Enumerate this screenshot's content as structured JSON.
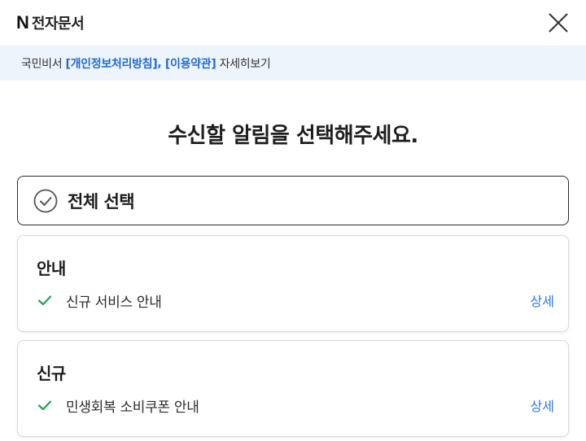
{
  "header": {
    "logo": "N",
    "title": "전자문서"
  },
  "notice": {
    "prefix": "국민비서 ",
    "privacy_link": "[개인정보처리방침]",
    "separator": ", ",
    "terms_link": "[이용약관]",
    "suffix": " 자세히보기"
  },
  "main": {
    "title": "수신할 알림을 선택해주세요.",
    "select_all_label": "전체 선택"
  },
  "categories": [
    {
      "title": "안내",
      "items": [
        {
          "label": "신규 서비스 안내",
          "detail": "상세",
          "checked": true
        }
      ]
    },
    {
      "title": "신규",
      "items": [
        {
          "label": "민생회복 소비쿠폰 안내",
          "detail": "상세",
          "checked": true
        }
      ]
    }
  ],
  "colors": {
    "accent": "#2c7be5",
    "link": "#1f6bd1",
    "check_green": "#1aa35c",
    "notice_bg": "#eef4fb"
  }
}
